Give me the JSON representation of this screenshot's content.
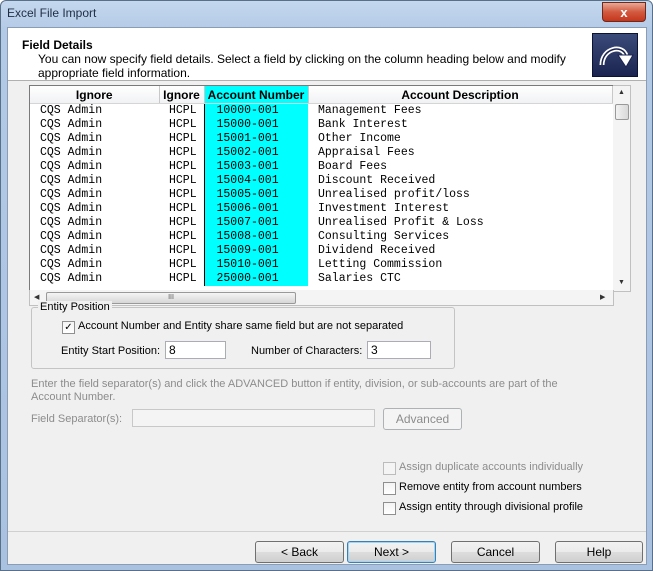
{
  "window": {
    "title": "Excel File Import",
    "close_glyph": "x"
  },
  "header": {
    "title": "Field Details",
    "description": "You can now specify field details. Select a field by clicking on the column heading below and modify appropriate field information."
  },
  "grid": {
    "columns": [
      "Ignore",
      "Ignore",
      "Account Number",
      "Account Description"
    ],
    "rows": [
      [
        "CQS Admin",
        "HCPL",
        "10000-001",
        "Management Fees"
      ],
      [
        "CQS Admin",
        "HCPL",
        "15000-001",
        "Bank Interest"
      ],
      [
        "CQS Admin",
        "HCPL",
        "15001-001",
        "Other Income"
      ],
      [
        "CQS Admin",
        "HCPL",
        "15002-001",
        "Appraisal Fees"
      ],
      [
        "CQS Admin",
        "HCPL",
        "15003-001",
        "Board Fees"
      ],
      [
        "CQS Admin",
        "HCPL",
        "15004-001",
        "Discount Received"
      ],
      [
        "CQS Admin",
        "HCPL",
        "15005-001",
        "Unrealised profit/loss"
      ],
      [
        "CQS Admin",
        "HCPL",
        "15006-001",
        "Investment Interest"
      ],
      [
        "CQS Admin",
        "HCPL",
        "15007-001",
        "Unrealised Profit & Loss"
      ],
      [
        "CQS Admin",
        "HCPL",
        "15008-001",
        "Consulting Services"
      ],
      [
        "CQS Admin",
        "HCPL",
        "15009-001",
        "Dividend Received"
      ],
      [
        "CQS Admin",
        "HCPL",
        "15010-001",
        "Letting Commission"
      ],
      [
        "CQS Admin",
        "HCPL",
        "25000-001",
        "Salaries CTC"
      ]
    ],
    "selected_column_color": "#00ffff",
    "hscroll_thumb_glyph": "III"
  },
  "entity_position": {
    "group_label": "Entity Position",
    "same_field_label": "Account Number and Entity share same field but are not separated",
    "same_field_checked": true,
    "check_glyph": "✓",
    "start_label": "Entity Start Position:",
    "start_value": "8",
    "chars_label": "Number of Characters:",
    "chars_value": "3"
  },
  "separator": {
    "instructions": "Enter the field separator(s) and click the ADVANCED button if entity, division, or sub-accounts are part of the Account Number.",
    "label": "Field Separator(s):",
    "value": "",
    "advanced_label": "Advanced"
  },
  "options": {
    "assign_duplicates": "Assign duplicate accounts individually",
    "remove_entity": "Remove entity from account numbers",
    "assign_entity": "Assign entity through divisional profile"
  },
  "buttons": {
    "back": "< Back",
    "next": "Next >",
    "cancel": "Cancel",
    "help": "Help"
  }
}
